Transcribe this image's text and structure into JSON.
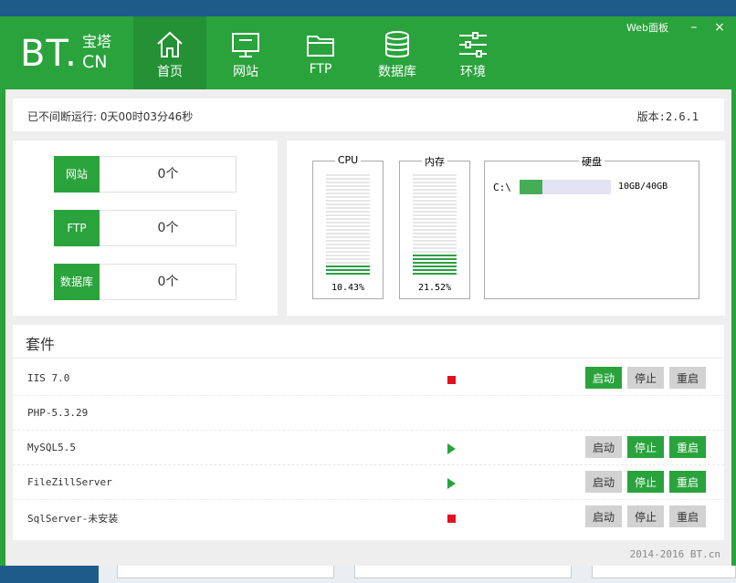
{
  "app": {
    "logo_main": "BT.",
    "logo_cn_top": "宝塔",
    "logo_cn_bottom": "CN",
    "web_panel_label": "Web面板",
    "minimize_label": "–",
    "close_label": "×"
  },
  "nav": [
    {
      "label": "首页",
      "icon": "home-icon"
    },
    {
      "label": "网站",
      "icon": "monitor-icon"
    },
    {
      "label": "FTP",
      "icon": "folder-icon"
    },
    {
      "label": "数据库",
      "icon": "database-icon"
    },
    {
      "label": "环境",
      "icon": "sliders-icon"
    }
  ],
  "status": {
    "uptime": "已不间断运行: 0天00时03分46秒",
    "version": "版本:2.6.1"
  },
  "stats": [
    {
      "label": "网站",
      "value": "0个"
    },
    {
      "label": "FTP",
      "value": "0个"
    },
    {
      "label": "数据库",
      "value": "0个"
    }
  ],
  "monitor": {
    "cpu": {
      "title": "CPU",
      "percent_text": "10.43%",
      "level": 0.1043
    },
    "memory": {
      "title": "内存",
      "percent_text": "21.52%",
      "level": 0.2152
    },
    "disk": {
      "title": "硬盘",
      "drive": "C:\\",
      "size_text": "10GB/40GB",
      "level": 0.25
    }
  },
  "suite": {
    "title": "套件",
    "start_label": "启动",
    "stop_label": "停止",
    "restart_label": "重启",
    "rows": [
      {
        "name": "IIS 7.0",
        "status": "stopped",
        "buttons": true,
        "start_active": true
      },
      {
        "name": "PHP-5.3.29",
        "status": "none",
        "buttons": false,
        "start_active": false
      },
      {
        "name": "MySQL5.5",
        "status": "running",
        "buttons": true,
        "start_active": false
      },
      {
        "name": "FileZillServer",
        "status": "running",
        "buttons": true,
        "start_active": false
      },
      {
        "name": "SqlServer-未安装",
        "status": "stopped",
        "buttons": true,
        "start_active": false
      }
    ]
  },
  "footer": "2014-2016 BT.cn",
  "colors": {
    "brand_green": "#2aa33c",
    "stop_red": "#e0101e",
    "gauge_fill": "#2e9e43"
  }
}
